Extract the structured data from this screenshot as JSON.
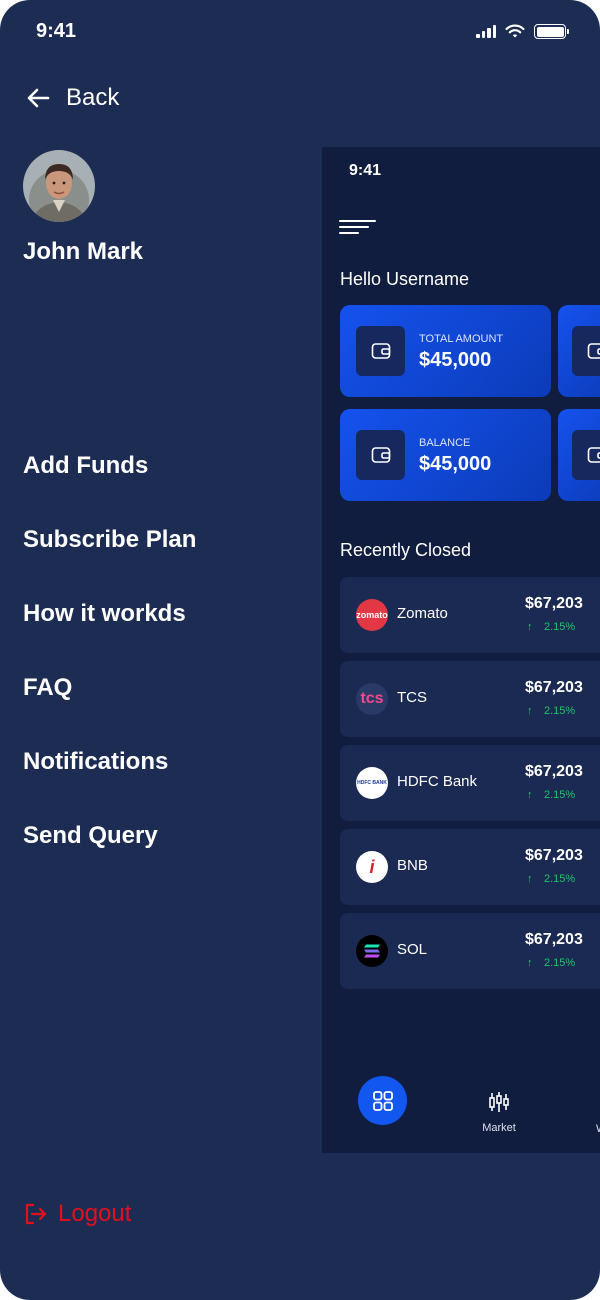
{
  "status_bar": {
    "time": "9:41"
  },
  "drawer": {
    "back_label": "Back",
    "user_name": "John Mark",
    "menu": [
      {
        "label": "Add Funds"
      },
      {
        "label": "Subscribe Plan"
      },
      {
        "label": "How it workds"
      },
      {
        "label": "FAQ"
      },
      {
        "label": "Notifications"
      },
      {
        "label": "Send Query"
      }
    ],
    "logout_label": "Logout"
  },
  "preview": {
    "time": "9:41",
    "greeting": "Hello Username",
    "cards": [
      {
        "label": "TOTAL AMOUNT",
        "value": "$45,000"
      },
      {
        "label": "BALANCE",
        "value": "$45,000"
      }
    ],
    "section_title": "Recently Closed",
    "stocks": [
      {
        "name": "Zomato",
        "logo_text": "zomato",
        "price": "$67,203",
        "change": "2.15%"
      },
      {
        "name": "TCS",
        "logo_text": "tcs",
        "price": "$67,203",
        "change": "2.15%"
      },
      {
        "name": "HDFC Bank",
        "logo_text": "HDFC BANK",
        "price": "$67,203",
        "change": "2.15%"
      },
      {
        "name": "BNB",
        "logo_text": "i",
        "price": "$67,203",
        "change": "2.15%"
      },
      {
        "name": "SOL",
        "logo_text": "",
        "price": "$67,203",
        "change": "2.15%"
      }
    ],
    "nav": {
      "market_label": "Market",
      "peek_label": "W"
    }
  },
  "colors": {
    "background": "#1c2c52",
    "preview_background": "#111d3e",
    "accent_blue": "#1157f0",
    "logout_red": "#e3101c",
    "gain_green": "#21c36b"
  },
  "icons": [
    "arrow-left-icon",
    "signal-icon",
    "wifi-icon",
    "battery-icon",
    "logout-icon",
    "hamburger-icon",
    "wallet-icon",
    "arrow-up-icon",
    "grid-icon",
    "candlestick-icon"
  ]
}
